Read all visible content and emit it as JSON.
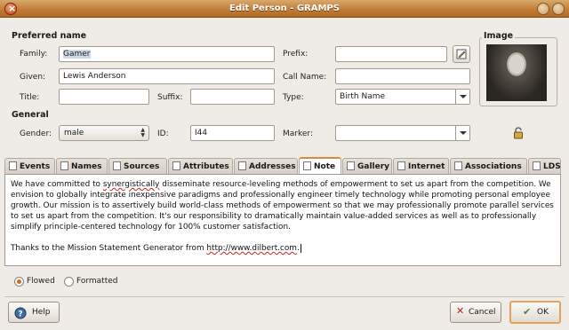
{
  "window": {
    "title": "Edit Person - GRAMPS"
  },
  "sections": {
    "preferred_name": "Preferred name",
    "general": "General",
    "image": "Image"
  },
  "fields": {
    "family": {
      "label": "Family:",
      "value": "Gamer"
    },
    "prefix": {
      "label": "Prefix:",
      "value": ""
    },
    "given": {
      "label": "Given:",
      "value": "Lewis Anderson"
    },
    "call_name": {
      "label": "Call Name:",
      "value": ""
    },
    "title": {
      "label": "Title:",
      "value": ""
    },
    "suffix": {
      "label": "Suffix:",
      "value": ""
    },
    "type": {
      "label": "Type:",
      "value": "Birth Name"
    },
    "gender": {
      "label": "Gender:",
      "value": "male"
    },
    "id": {
      "label": "ID:",
      "value": "I44"
    },
    "marker": {
      "label": "Marker:",
      "value": ""
    }
  },
  "tabs": [
    {
      "label": "Events",
      "icon": "events-icon"
    },
    {
      "label": "Names",
      "icon": "names-icon"
    },
    {
      "label": "Sources",
      "icon": "sources-icon"
    },
    {
      "label": "Attributes",
      "icon": "attributes-icon"
    },
    {
      "label": "Addresses",
      "icon": "addresses-icon"
    },
    {
      "label": "Note",
      "icon": "note-icon",
      "active": true
    },
    {
      "label": "Gallery",
      "icon": "gallery-icon"
    },
    {
      "label": "Internet",
      "icon": "internet-icon"
    },
    {
      "label": "Associations",
      "icon": "associations-icon"
    },
    {
      "label": "LDS",
      "icon": "lds-icon"
    }
  ],
  "note": {
    "p1_a": "We have committed to ",
    "p1_misspelled": "synergistically",
    "p1_b": " disseminate resource-leveling methods of empowerment to set us apart from the competition. We envision to globally integrate inexpensive paradigms and professionally engineer timely technology while promoting personal employee growth. Our mission is to assertively build world-class methods of empowerment so that we may professionally promote parallel services to set us apart from the competition. It's our responsibility to dramatically maintain value-added services as well as to professionally simplify principle-centered technology for 100% customer satisfaction.",
    "p2_a": "Thanks to the Mission Statement Generator from ",
    "p2_url": "http://www.dilbert.com",
    "p2_b": "."
  },
  "format": {
    "flowed": "Flowed",
    "formatted": "Formatted",
    "selected": "flowed"
  },
  "buttons": {
    "help": "Help",
    "cancel": "Cancel",
    "ok": "OK"
  },
  "colors": {
    "titlebar": "#c07a34",
    "accent": "#d98a3c",
    "background": "#efebe7"
  }
}
